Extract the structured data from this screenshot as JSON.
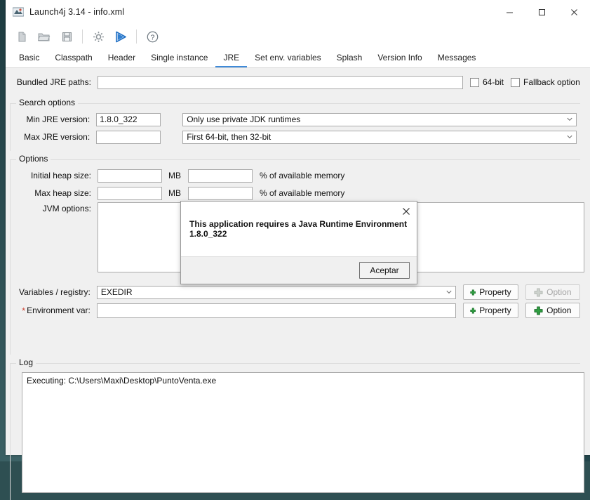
{
  "window": {
    "title": "Launch4j 3.14 - info.xml",
    "icon": "launch4j-app-icon",
    "controls": {
      "minimize": "–",
      "maximize": "☐",
      "close": "✕"
    }
  },
  "toolbar": {
    "items": [
      {
        "name": "new-file-icon",
        "label": "New"
      },
      {
        "name": "open-folder-icon",
        "label": "Open"
      },
      {
        "name": "save-icon",
        "label": "Save"
      },
      {
        "name": "settings-gear-icon",
        "label": "Settings"
      },
      {
        "name": "run-play-icon",
        "label": "Build wrapper / Run"
      },
      {
        "name": "help-question-icon",
        "label": "Help"
      }
    ]
  },
  "tabs": {
    "items": [
      {
        "label": "Basic",
        "active": false
      },
      {
        "label": "Classpath",
        "active": false
      },
      {
        "label": "Header",
        "active": false
      },
      {
        "label": "Single instance",
        "active": false
      },
      {
        "label": "JRE",
        "active": true
      },
      {
        "label": "Set env. variables",
        "active": false
      },
      {
        "label": "Splash",
        "active": false
      },
      {
        "label": "Version Info",
        "active": false
      },
      {
        "label": "Messages",
        "active": false
      }
    ]
  },
  "jre": {
    "bundled": {
      "label": "Bundled JRE paths:",
      "value": "",
      "placeholder": "",
      "checkbox_64bit": {
        "label": "64-bit",
        "checked": false
      },
      "checkbox_fallback": {
        "label": "Fallback option",
        "checked": false
      }
    },
    "search_options": {
      "title": "Search options",
      "min_jre": {
        "label": "Min JRE version:",
        "value": "1.8.0_322"
      },
      "max_jre": {
        "label": "Max JRE version:",
        "value": ""
      },
      "runtime_select": {
        "value": "Only use private JDK runtimes"
      },
      "bitness_select": {
        "value": "First 64-bit, then 32-bit"
      }
    },
    "options": {
      "title": "Options",
      "initial_heap": {
        "label": "Initial heap size:",
        "value": "",
        "unit": "MB",
        "percent_value": "",
        "percent_label": "% of available memory"
      },
      "max_heap": {
        "label": "Max heap size:",
        "value": "",
        "unit": "MB",
        "percent_value": "",
        "percent_label": "% of available memory"
      },
      "jvm_options": {
        "label": "JVM options:",
        "value": ""
      }
    },
    "variables": {
      "registry": {
        "label": "Variables / registry:",
        "value": "EXEDIR",
        "property_button": "Property",
        "option_button": "Option",
        "option_disabled": true
      },
      "environment": {
        "label": "Environment var:",
        "required_marker": "*",
        "value": "",
        "property_button": "Property",
        "option_button": "Option",
        "option_disabled": false
      }
    }
  },
  "log": {
    "title": "Log",
    "lines": [
      "Executing: C:\\Users\\Maxi\\Desktop\\PuntoVenta.exe"
    ]
  },
  "dialog": {
    "message": "This application requires a Java Runtime Environment 1.8.0_322",
    "ok_button": "Aceptar",
    "close_icon": "✕"
  },
  "colors": {
    "accent": "#3f8ad8",
    "green": "#2f9e41",
    "required": "#d04a3a",
    "window_bg": "#f0f0f0"
  }
}
